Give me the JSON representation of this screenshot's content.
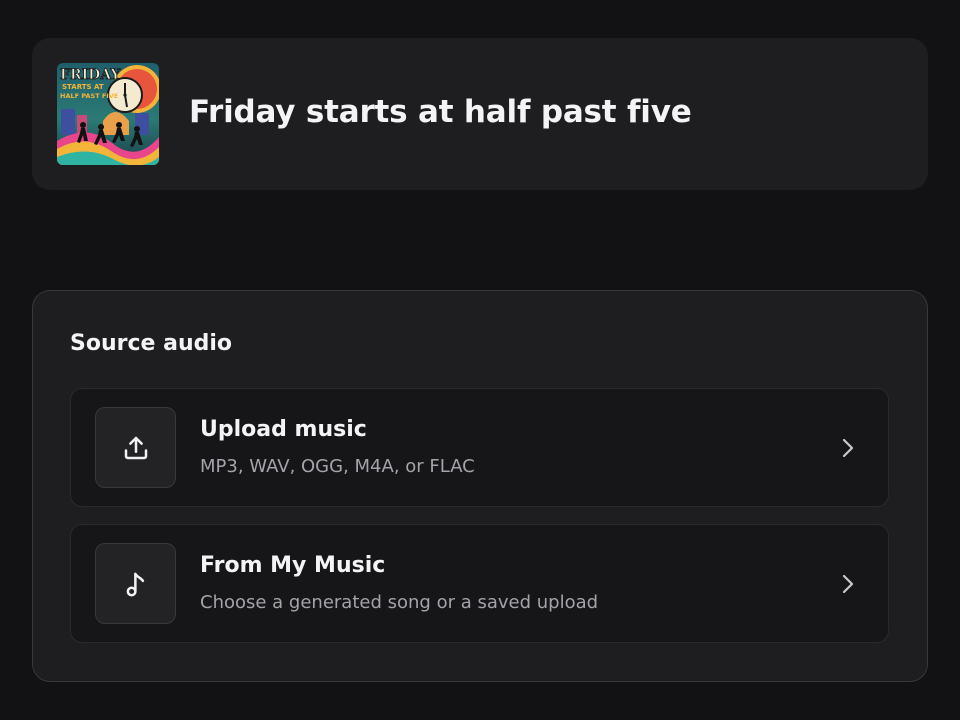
{
  "header": {
    "song_title": "Friday starts at half past five",
    "cover_icon": "album-cover-art",
    "cover_art_text": [
      "FRIDAY",
      "STARTS AT",
      "HALF PAST FIVE"
    ]
  },
  "source": {
    "title": "Source audio",
    "options": [
      {
        "icon": "upload-icon",
        "title": "Upload music",
        "subtitle": "MP3, WAV, OGG, M4A, or FLAC"
      },
      {
        "icon": "music-note-icon",
        "title": "From My Music",
        "subtitle": "Choose a generated song or a saved upload"
      }
    ]
  },
  "colors": {
    "background": "#121214",
    "card": "#1e1e21",
    "option_bg": "#161618",
    "text_primary": "#f4f4f6",
    "text_secondary": "#a3a3aa"
  }
}
